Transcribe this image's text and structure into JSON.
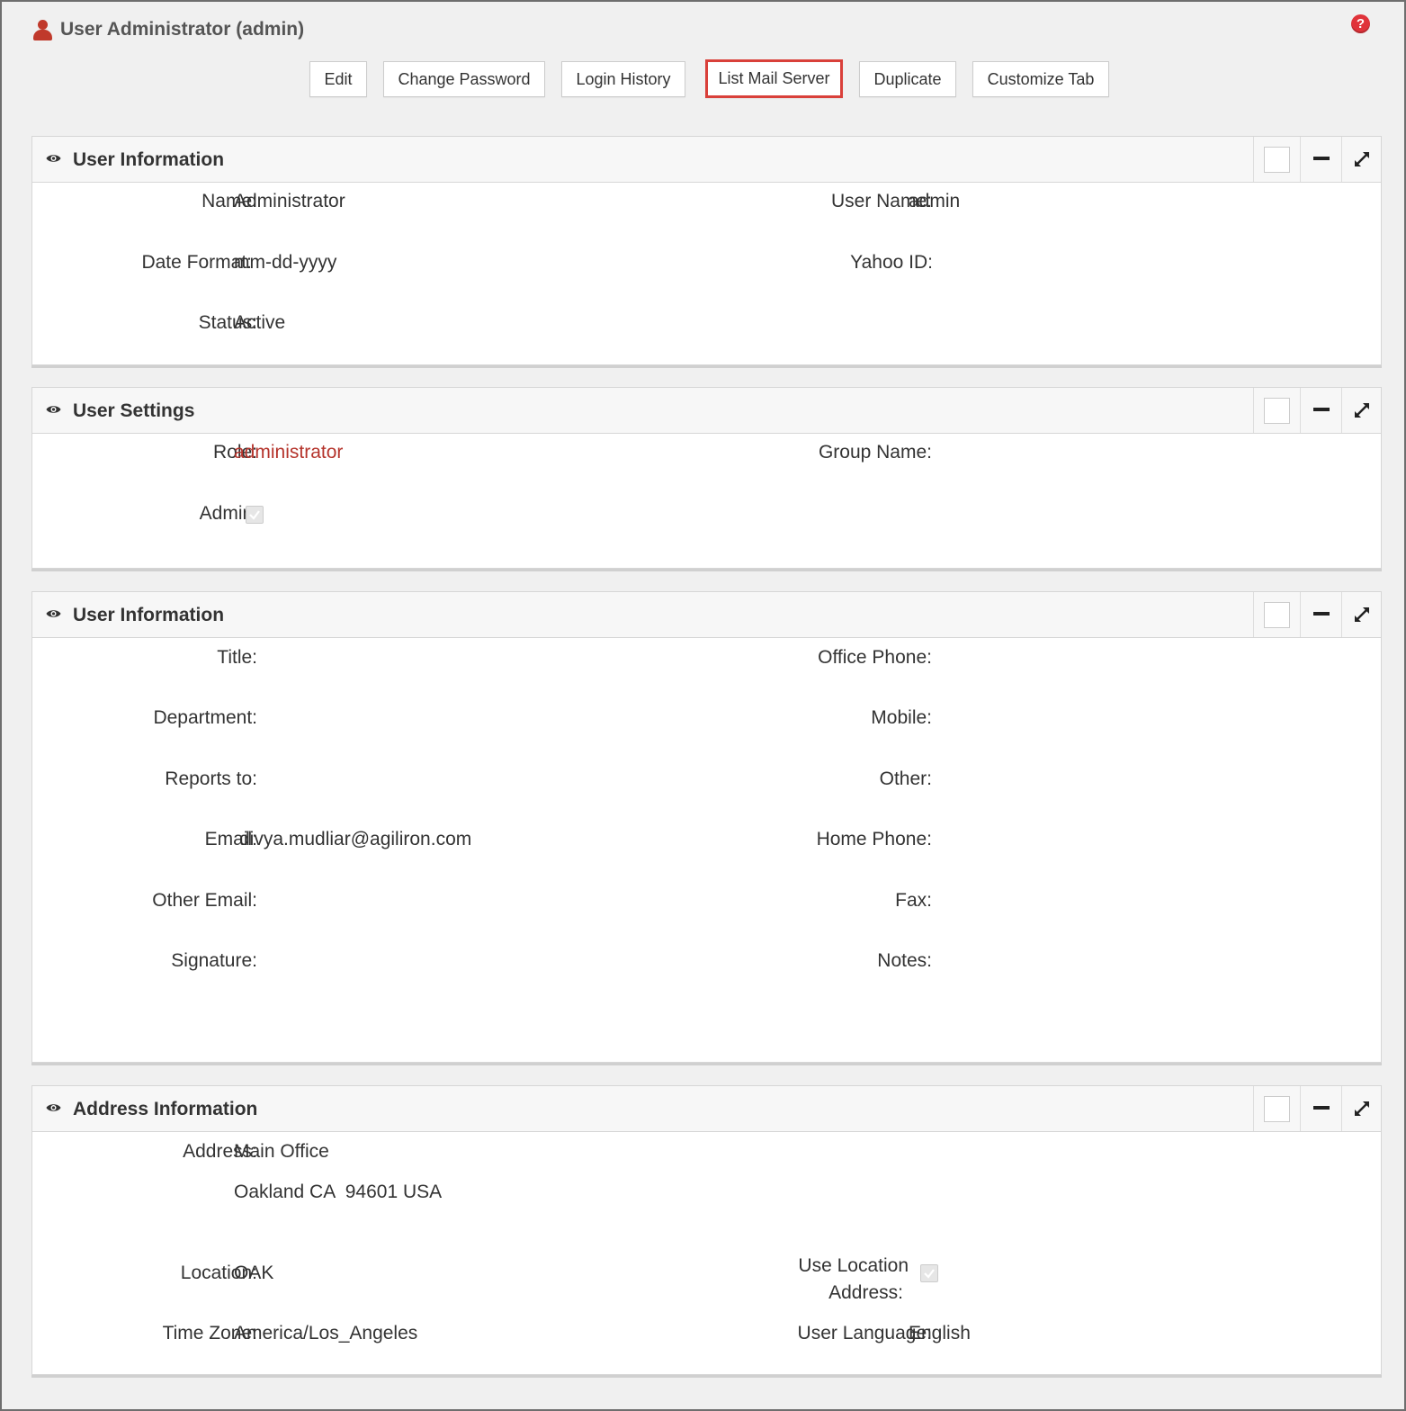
{
  "header": {
    "title": "User Administrator (admin)"
  },
  "toolbar": {
    "edit": "Edit",
    "change_password": "Change Password",
    "login_history": "Login History",
    "list_mail_server": "List Mail Server",
    "duplicate": "Duplicate",
    "customize_tab": "Customize Tab"
  },
  "panel_user_info": {
    "title": "User Information",
    "name_label": "Name:",
    "name_value": "Administrator",
    "username_label": "User Name:",
    "username_value": "admin",
    "date_format_label": "Date Format:",
    "date_format_value": "mm-dd-yyyy",
    "yahoo_label": "Yahoo ID:",
    "status_label": "Status:",
    "status_value": "Active"
  },
  "panel_user_settings": {
    "title": "User Settings",
    "role_label": "Role:",
    "role_value": "administrator",
    "group_label": "Group Name:",
    "admin_label": "Admin:",
    "admin_checked": true
  },
  "panel_user_info_2": {
    "title": "User Information",
    "title_label": "Title:",
    "office_phone_label": "Office Phone:",
    "department_label": "Department:",
    "mobile_label": "Mobile:",
    "reports_to_label": "Reports to:",
    "other_label": "Other:",
    "email_label": "Email:",
    "email_value": "divya.mudliar@agiliron.com",
    "home_phone_label": "Home Phone:",
    "other_email_label": "Other Email:",
    "fax_label": "Fax:",
    "signature_label": "Signature:",
    "notes_label": "Notes:"
  },
  "panel_address": {
    "title": "Address Information",
    "address_label": "Address:",
    "address_line1": "Main Office",
    "address_line2": "Oakland CA  94601 USA",
    "location_label": "Location:",
    "location_value": "OAK",
    "use_location_label_1": "Use Location",
    "use_location_label_2": "Address:",
    "use_location_checked": true,
    "timezone_label": "Time Zone:",
    "timezone_value": "America/Los_Angeles",
    "language_label": "User Language:",
    "language_value": "English"
  },
  "colors": {
    "accent_red": "#c0392b",
    "link": "#b5342c",
    "highlight_border": "#d9403a"
  },
  "icons": {
    "header": "user-icon",
    "help": "help-icon",
    "section": "eye-icon",
    "minimize": "minus-icon",
    "maximize": "expand-icon"
  }
}
